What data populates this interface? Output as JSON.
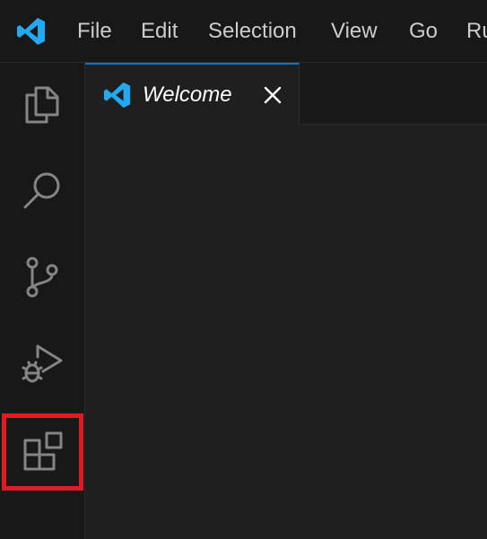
{
  "menu": {
    "items": [
      {
        "label": "File"
      },
      {
        "label": "Edit"
      },
      {
        "label": "Selection"
      },
      {
        "label": "View"
      },
      {
        "label": "Go"
      },
      {
        "label": "Ru"
      }
    ]
  },
  "activity_bar": {
    "items": [
      {
        "name": "explorer",
        "icon": "files-icon"
      },
      {
        "name": "search",
        "icon": "search-icon"
      },
      {
        "name": "source-control",
        "icon": "source-control-icon"
      },
      {
        "name": "run-and-debug",
        "icon": "run-debug-icon"
      },
      {
        "name": "extensions",
        "icon": "extensions-icon",
        "highlighted": true
      }
    ]
  },
  "editor": {
    "tabs": [
      {
        "label": "Welcome",
        "icon": "vscode-logo-icon",
        "active": true,
        "italic": true
      }
    ]
  },
  "colors": {
    "accent": "#0078d4",
    "logo_blue": "#23a9f2",
    "highlight_red": "#e21b23",
    "icon_gray": "#858585"
  }
}
